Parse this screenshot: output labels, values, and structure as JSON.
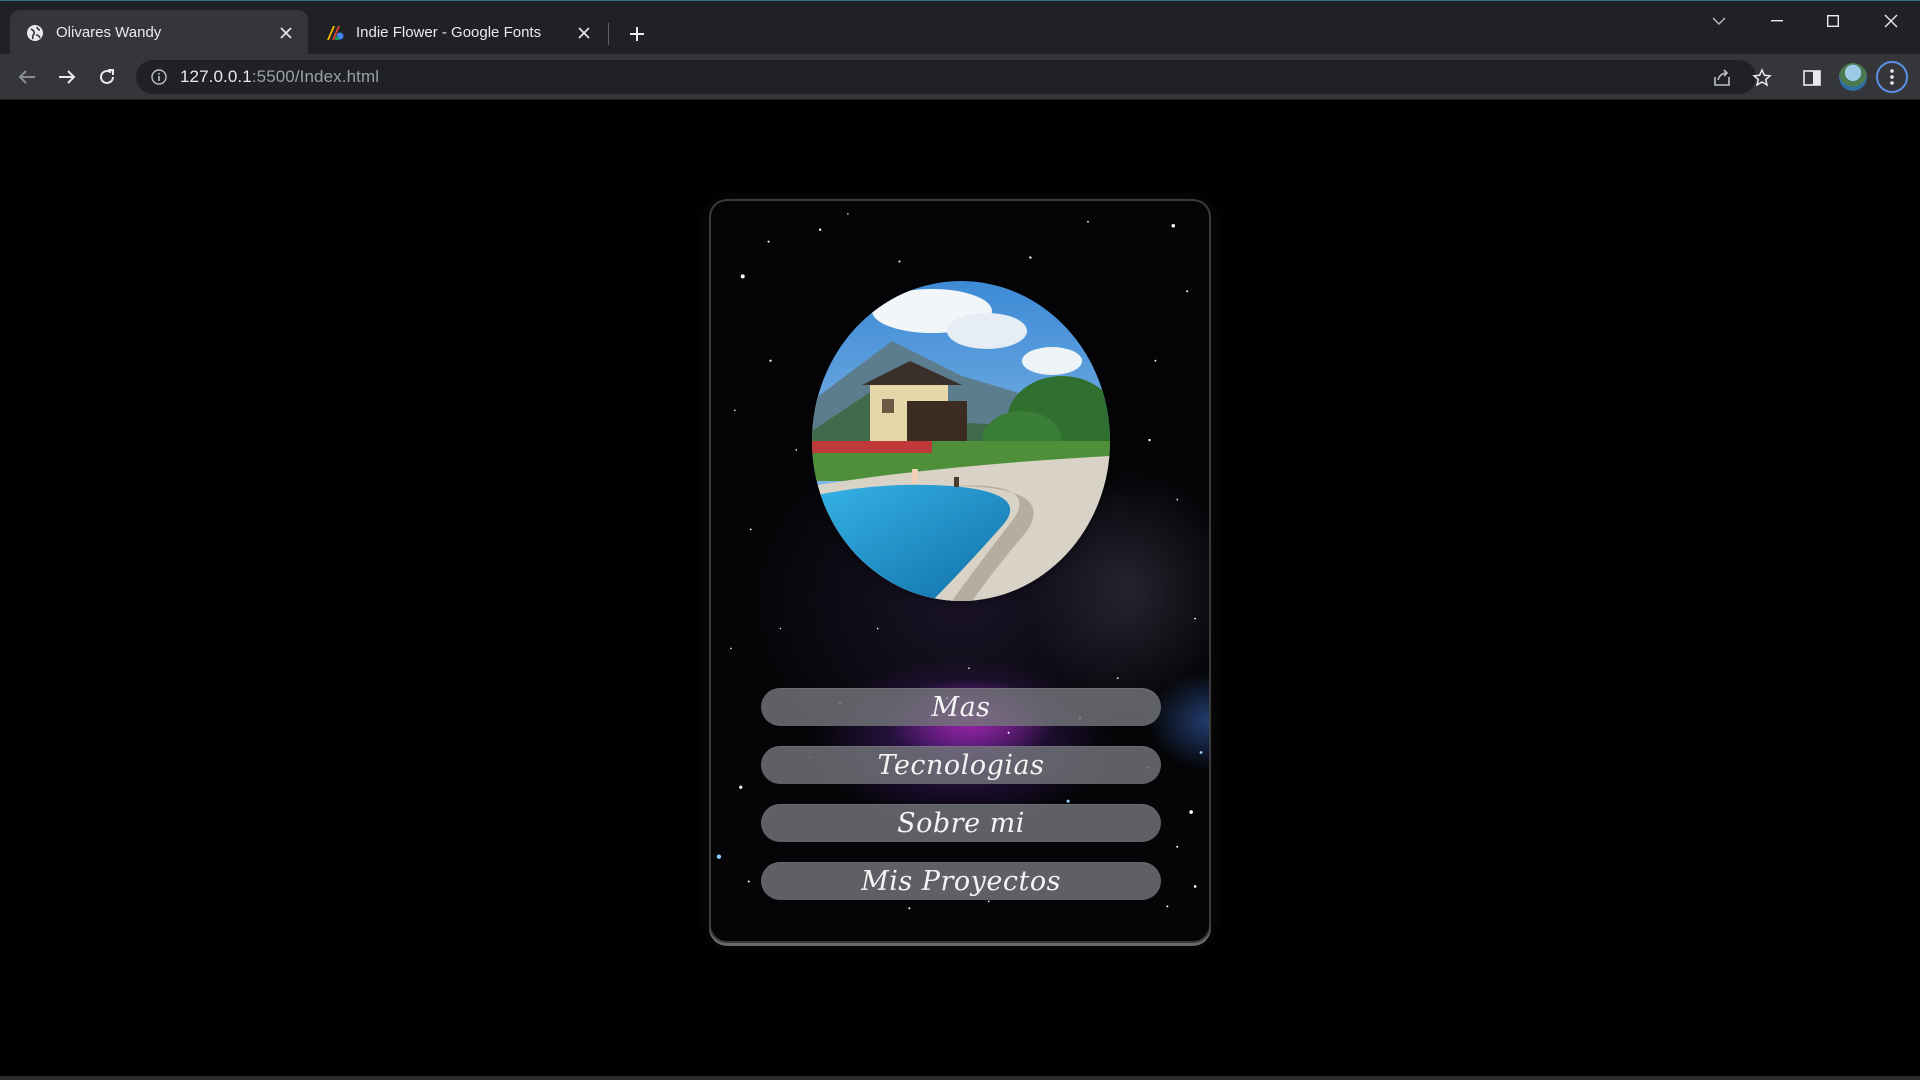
{
  "browser": {
    "tabs": [
      {
        "title": "Olivares Wandy",
        "favicon": "globe-icon",
        "active": true
      },
      {
        "title": "Indie Flower - Google Fonts",
        "favicon": "google-fonts-icon",
        "active": false
      }
    ],
    "url_host": "127.0.0.1",
    "url_rest": ":5500/Index.html"
  },
  "page": {
    "buttons": [
      {
        "label": "Mas"
      },
      {
        "label": "Tecnologias"
      },
      {
        "label": "Sobre mi"
      },
      {
        "label": "Mis Proyectos"
      }
    ]
  },
  "colors": {
    "page_background": "#000000",
    "tab_strip": "#202124",
    "toolbar": "#35363a",
    "button_fill": "#73757a",
    "button_text": "#f4f4f4"
  }
}
